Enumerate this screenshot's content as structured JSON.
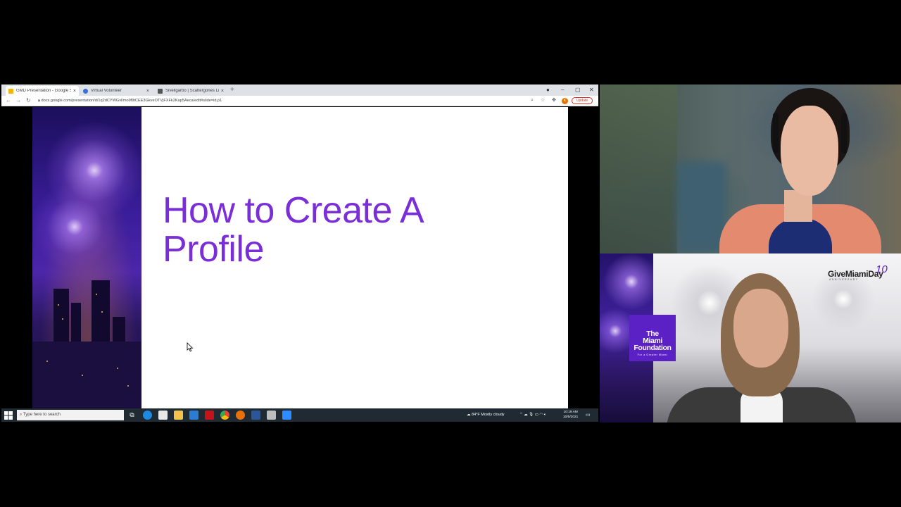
{
  "browser": {
    "tabs": [
      {
        "label": "GMD Presentation - Google Slid",
        "favicon_color": "#f4b400",
        "active": true
      },
      {
        "label": "Virtual Volunteer",
        "favicon_color": "#3b6fd8",
        "active": false
      },
      {
        "label": "Sivellgarbo | Scattergories List Ge",
        "favicon_color": "#555555",
        "active": false
      }
    ],
    "new_tab": "+",
    "window_controls": {
      "minimize": "–",
      "maximize": "▢",
      "close": "✕"
    },
    "nav": {
      "back": "←",
      "forward": "→",
      "reload": "↻"
    },
    "url": "docs.google.com/presentation/d/1q2dCYWGvl/mo9f9tCEE3GkveOTVjFXFk2Kap5Aeca/edit#slide=id.p1",
    "toolbar_icons": [
      "zoom-icon",
      "star-icon",
      "extensions-icon"
    ],
    "profile_initial": "K",
    "update_label": "Update"
  },
  "slide": {
    "title_line1": "How to Create A",
    "title_line2": "Profile",
    "title_color": "#7a2ed8"
  },
  "taskbar": {
    "search_placeholder": "Type here to search",
    "weather": "84°F  Mostly cloudy",
    "time": "10:19 AM",
    "date": "10/5/2021"
  },
  "video2": {
    "foundation_line1": "The",
    "foundation_line2": "Miami",
    "foundation_line3": "Foundation",
    "foundation_tagline": "For a Greater Miami",
    "brand_name": "GiveMiamiDay",
    "brand_number": "10",
    "brand_sub": "ANNIVERSARY"
  },
  "colors": {
    "accent_purple": "#5b21c4",
    "taskbar": "#1f2a33",
    "update_red": "#d93025"
  }
}
